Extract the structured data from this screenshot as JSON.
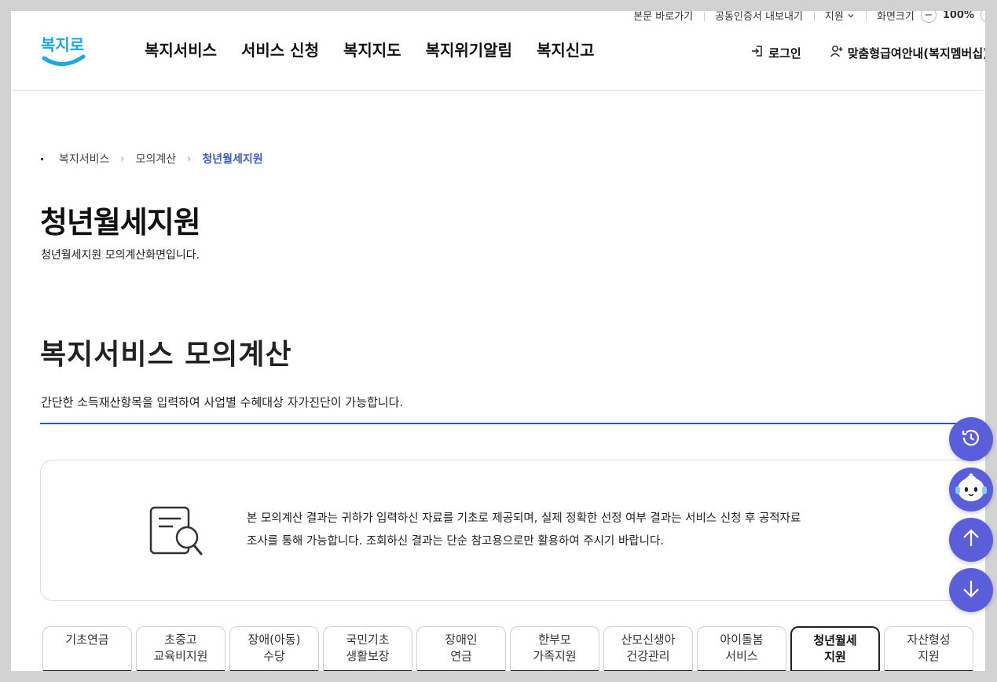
{
  "util": {
    "skip": "본문 바로가기",
    "cert": "공동인증서 내보내기",
    "support": "지원",
    "screen_size": "화면크기",
    "zoom_minus": "−",
    "zoom_value": "100%",
    "zoom_plus": "+"
  },
  "header": {
    "logo_text": "복지로",
    "nav": [
      "복지서비스",
      "서비스 신청",
      "복지지도",
      "복지위기알림",
      "복지신고"
    ],
    "login": "로그인",
    "membership": "맞춤형급여안내(복지멤버십)"
  },
  "breadcrumb": [
    "복지서비스",
    "모의계산",
    "청년월세지원"
  ],
  "page": {
    "title": "청년월세지원",
    "desc": "청년월세지원 모의계산화면입니다.",
    "section_title": "복지서비스 모의계산",
    "section_desc": "간단한 소득재산항목을 입력하여 사업별 수혜대상 자가진단이 가능합니다."
  },
  "notice": {
    "line1": "본 모의계산 결과는 귀하가 입력하신 자료를 기초로 제공되며, 실제 정확한 선정 여부 결과는 서비스 신청 후 공적자료",
    "line2": "조사를 통해 가능합니다. 조회하신 결과는 단순 참고용으로만 활용하여 주시기 바랍니다."
  },
  "tabs": [
    {
      "l1": "기초연금",
      "l2": ""
    },
    {
      "l1": "초중고",
      "l2": "교육비지원"
    },
    {
      "l1": "장애(아동)",
      "l2": "수당"
    },
    {
      "l1": "국민기초",
      "l2": "생활보장"
    },
    {
      "l1": "장애인",
      "l2": "연금"
    },
    {
      "l1": "한부모",
      "l2": "가족지원"
    },
    {
      "l1": "산모신생아",
      "l2": "건강관리"
    },
    {
      "l1": "아이돌봄",
      "l2": "서비스"
    },
    {
      "l1": "청년월세",
      "l2": "지원"
    },
    {
      "l1": "자산형성",
      "l2": "지원"
    }
  ],
  "active_tab": 8,
  "colors": {
    "accent": "#3b5bcc",
    "float": "#5a5edb",
    "logo": "#1aa8e8"
  }
}
